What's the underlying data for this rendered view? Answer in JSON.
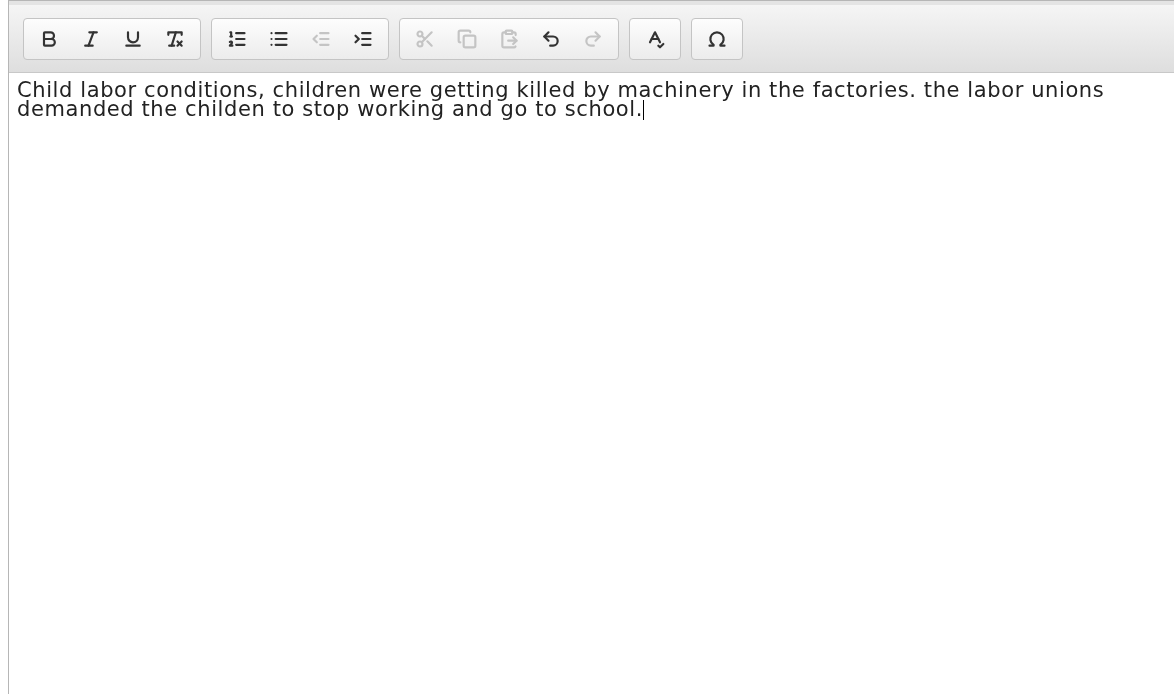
{
  "toolbar": {
    "groups": [
      {
        "buttons": [
          {
            "kind": "bold",
            "disabled": false
          },
          {
            "kind": "italic",
            "disabled": false
          },
          {
            "kind": "underline",
            "disabled": false
          },
          {
            "kind": "remove-format",
            "disabled": false
          }
        ]
      },
      {
        "buttons": [
          {
            "kind": "numbered-list",
            "disabled": false
          },
          {
            "kind": "bulleted-list",
            "disabled": false
          },
          {
            "kind": "outdent",
            "disabled": true
          },
          {
            "kind": "indent",
            "disabled": false
          }
        ]
      },
      {
        "buttons": [
          {
            "kind": "cut",
            "disabled": true
          },
          {
            "kind": "copy",
            "disabled": true
          },
          {
            "kind": "paste",
            "disabled": true
          },
          {
            "kind": "undo",
            "disabled": false
          },
          {
            "kind": "redo",
            "disabled": true
          }
        ]
      },
      {
        "buttons": [
          {
            "kind": "spellcheck",
            "disabled": false
          }
        ]
      },
      {
        "buttons": [
          {
            "kind": "special-char",
            "disabled": false
          }
        ]
      }
    ]
  },
  "editor": {
    "value": "Child labor conditions, children were getting killed by machinery in the factories. the labor unions demanded the childen to stop working and go to school."
  }
}
